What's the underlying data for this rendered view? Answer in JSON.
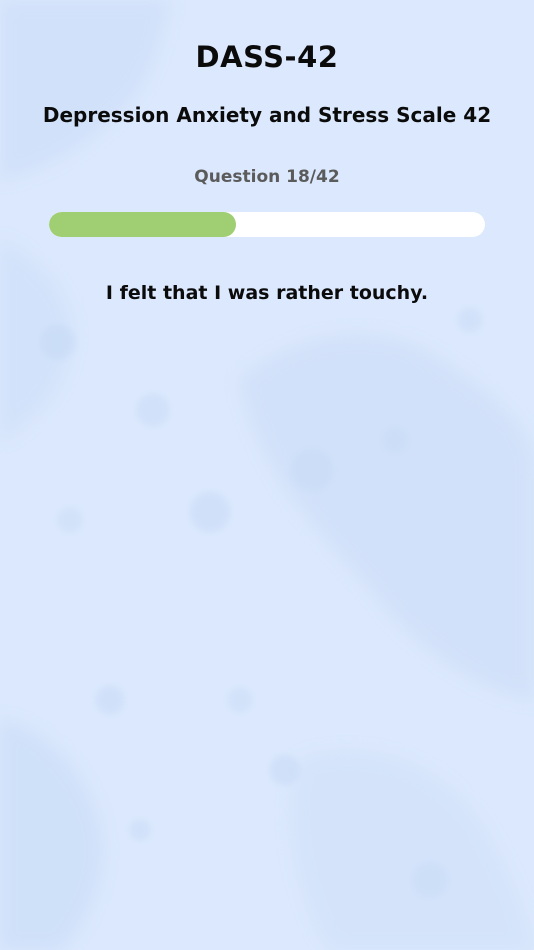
{
  "header": {
    "title": "DASS-42",
    "subtitle": "Depression Anxiety and Stress Scale 42"
  },
  "quiz": {
    "counter_text": "Question 18/42",
    "current": 18,
    "total": 42,
    "progress_fraction": 0.4286,
    "question": "I felt that I was rather touchy."
  },
  "colors": {
    "background": "#dbe8fd",
    "progress_fill": "#9fce73",
    "progress_track": "#ffffff",
    "counter_text": "#5b5b5b"
  }
}
